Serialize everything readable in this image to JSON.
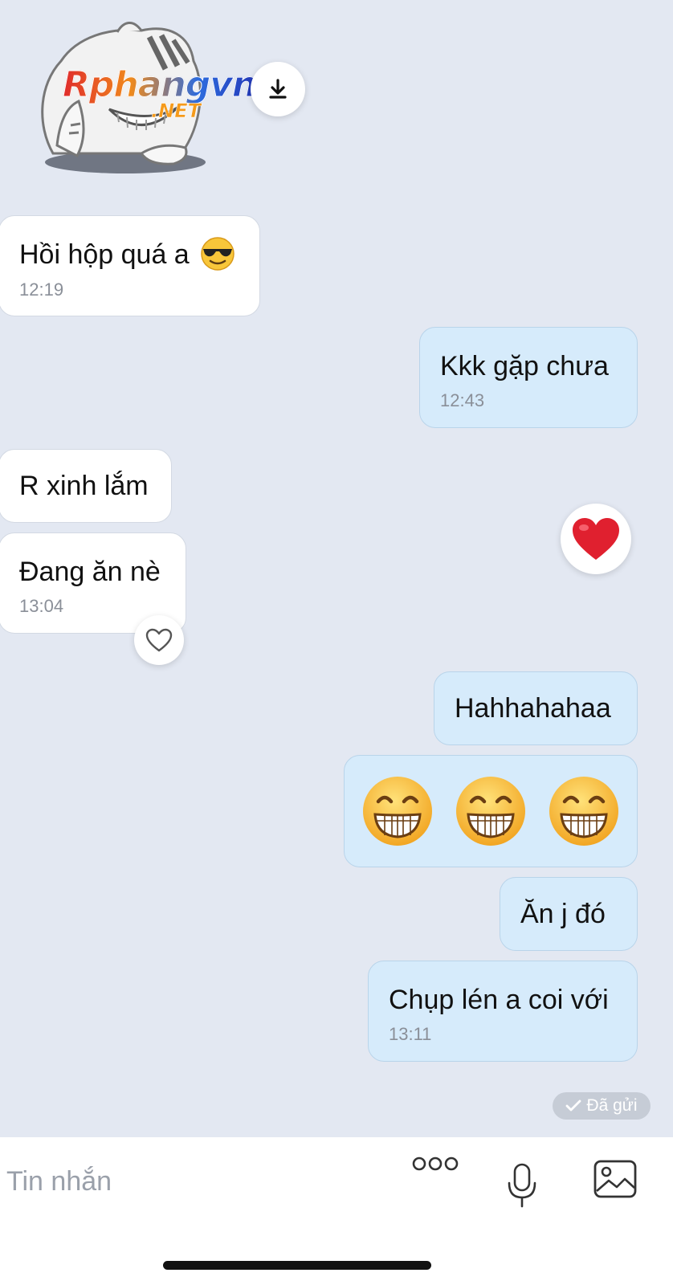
{
  "sticker": {
    "brand_text": "Rphangvn",
    "brand_sub": ".NET",
    "download_icon": "download-icon"
  },
  "messages": [
    {
      "side": "received",
      "text": "Hồi hộp quá a",
      "emoji": "smiling-face-with-sunglasses",
      "time": "12:19"
    },
    {
      "side": "sent",
      "text": "Kkk gặp chưa",
      "time": "12:43"
    },
    {
      "side": "received",
      "text": "R xinh lắm"
    },
    {
      "side": "received",
      "text": "Đang ăn nè",
      "time": "13:04",
      "reaction_button": "heart-outline-icon"
    },
    {
      "side": "sent",
      "text": "Hahhahahaa"
    },
    {
      "side": "sent",
      "emojis": [
        "grinning-face",
        "grinning-face",
        "grinning-face"
      ]
    },
    {
      "side": "sent",
      "text": "Ăn j đó"
    },
    {
      "side": "sent",
      "text": "Chụp lén a coi với",
      "time": "13:11"
    }
  ],
  "reaction": {
    "icon": "red-heart-icon"
  },
  "status": {
    "text": "Đã gửi",
    "icon": "checkmark-icon"
  },
  "composer": {
    "placeholder": "Tin nhắn",
    "more_icon": "more-dots-icon",
    "mic_icon": "microphone-icon",
    "image_icon": "image-icon"
  },
  "colors": {
    "background": "#e3e8f2",
    "received_bubble": "#ffffff",
    "sent_bubble": "#d6ebfb",
    "heart": "#e0202f"
  }
}
